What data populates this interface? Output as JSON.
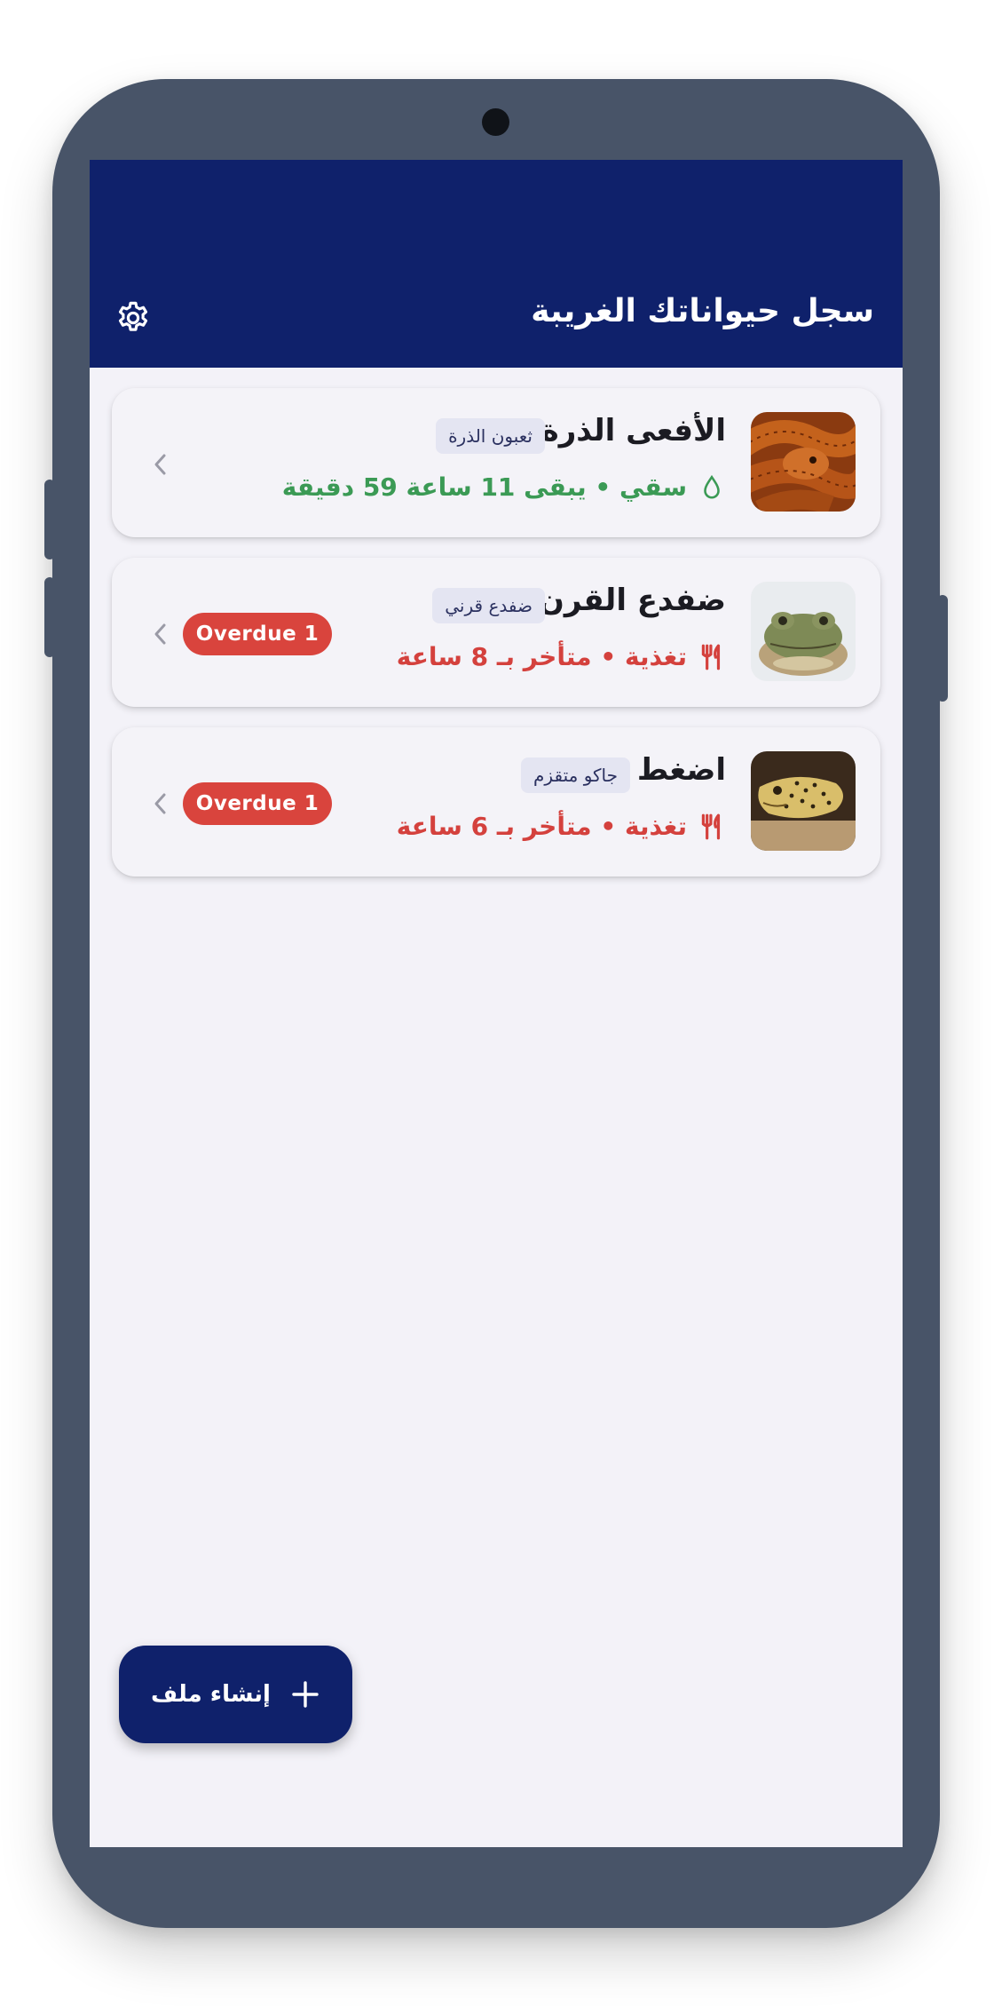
{
  "app": {
    "title": "سجل حيواناتك الغريبة",
    "settings_icon": "gear-icon"
  },
  "colors": {
    "appbar": "#0f216b",
    "background": "#f3f2f8",
    "ok_status": "#3b9a55",
    "overdue_status": "#d4413d",
    "badge": "#d9443d"
  },
  "pets": [
    {
      "name": "الأفعى الذرة",
      "species": "ثعبون الذرة",
      "status_text": "سقي • يبقى 11 ساعة 59 دقيقة",
      "status_icon": "water-drop-icon",
      "status_kind": "ok",
      "badge": null,
      "photo": "corn-snake-photo"
    },
    {
      "name": "ضفدع القرن",
      "species": "ضفدع قرني",
      "status_text": "تغذية • متأخر بـ 8 ساعة",
      "status_icon": "fork-knife-icon",
      "status_kind": "overdue",
      "badge": "Overdue 1",
      "photo": "horned-frog-photo"
    },
    {
      "name": "اضغط",
      "species": "جاكو متقزم",
      "status_text": "تغذية • متأخر بـ 6 ساعة",
      "status_icon": "fork-knife-icon",
      "status_kind": "overdue",
      "badge": "Overdue 1",
      "photo": "leopard-gecko-photo"
    }
  ],
  "fab": {
    "label": "إنشاء ملف",
    "icon": "plus-icon"
  }
}
